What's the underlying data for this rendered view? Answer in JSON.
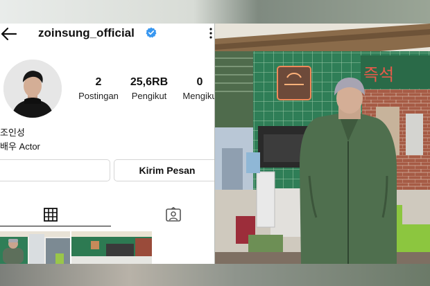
{
  "profile": {
    "username": "zoinsung_official",
    "name": "조인성",
    "bio": "배우 Actor"
  },
  "stats": [
    {
      "value": "2",
      "label": "Postingan"
    },
    {
      "value": "25,6RB",
      "label": "Pengikut"
    },
    {
      "value": "0",
      "label": "Mengiku"
    }
  ],
  "buttons": {
    "message": "Kirim Pesan"
  },
  "tabs": {
    "grid_icon": "grid-icon",
    "tagged_icon": "tagged-icon"
  },
  "icons": {
    "back": "back-arrow-icon",
    "verified": "verified-badge-icon",
    "more": "more-options-icon"
  },
  "photo": {
    "sign_text": "즉석"
  },
  "colors": {
    "verified": "#3897f0",
    "wall_tile": "#2f7e57",
    "coat": "#4f6f4e",
    "chair": "#8cc63f"
  }
}
